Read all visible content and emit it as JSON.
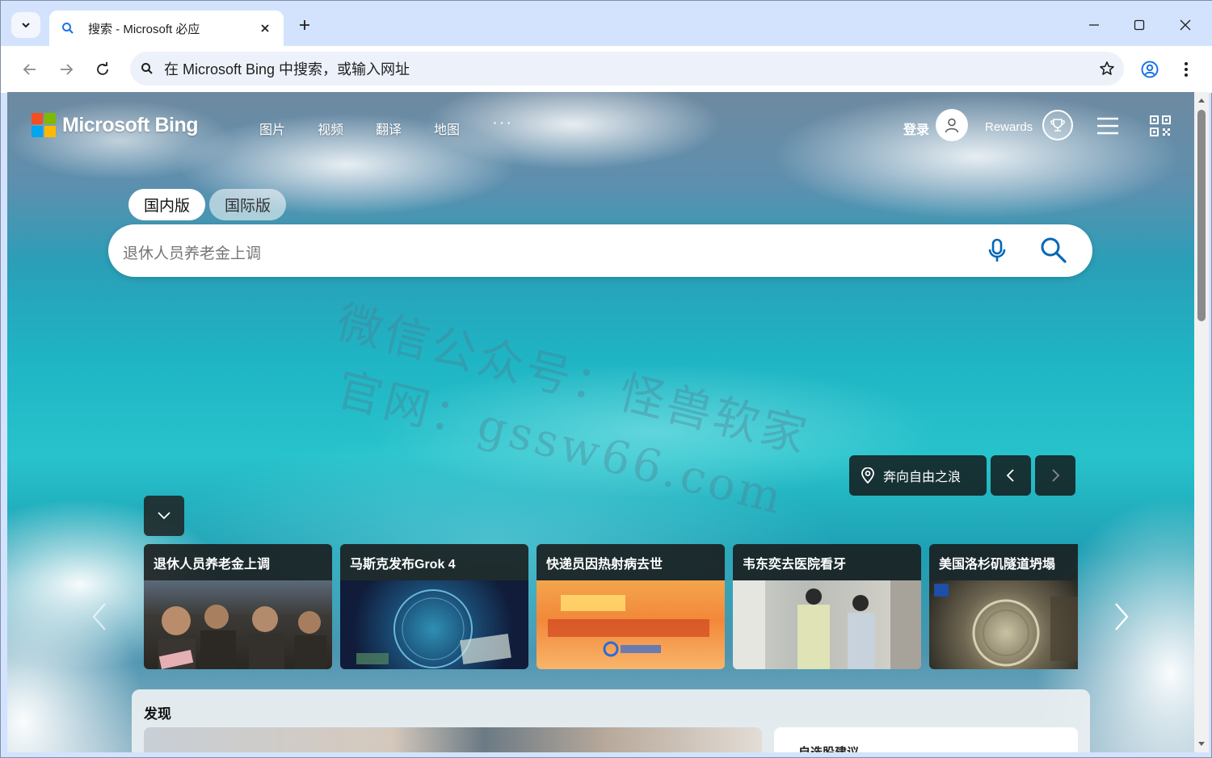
{
  "browser": {
    "tab_title": "搜索 - Microsoft 必应",
    "omnibox_text": "在 Microsoft Bing 中搜索，或输入网址"
  },
  "bing": {
    "logo_text": "Microsoft Bing",
    "nav": [
      "图片",
      "视频",
      "翻译",
      "地图"
    ],
    "nav_more": "···",
    "signin": "登录",
    "rewards": "Rewards",
    "tabs": {
      "domestic": "国内版",
      "international": "国际版"
    },
    "search_placeholder": "退休人员养老金上调",
    "image_title": "奔向自由之浪",
    "news": [
      {
        "title": "退休人员养老金上调"
      },
      {
        "title": "马斯克发布Grok 4"
      },
      {
        "title": "快递员因热射病去世"
      },
      {
        "title": "韦东奕去医院看牙"
      },
      {
        "title": "美国洛杉矶隧道坍塌"
      }
    ],
    "discover": {
      "title": "发现",
      "side_title": "自选股建议"
    },
    "watermark": {
      "line1": "微信公众号：怪兽软家",
      "line2": "官网：gssw66.com"
    }
  },
  "colors": {
    "accent": "#1a73e8",
    "bing_blue": "#0067b8",
    "ms_red": "#f25022",
    "ms_green": "#7fba00",
    "ms_blue": "#00a4ef",
    "ms_yellow": "#ffb900"
  }
}
